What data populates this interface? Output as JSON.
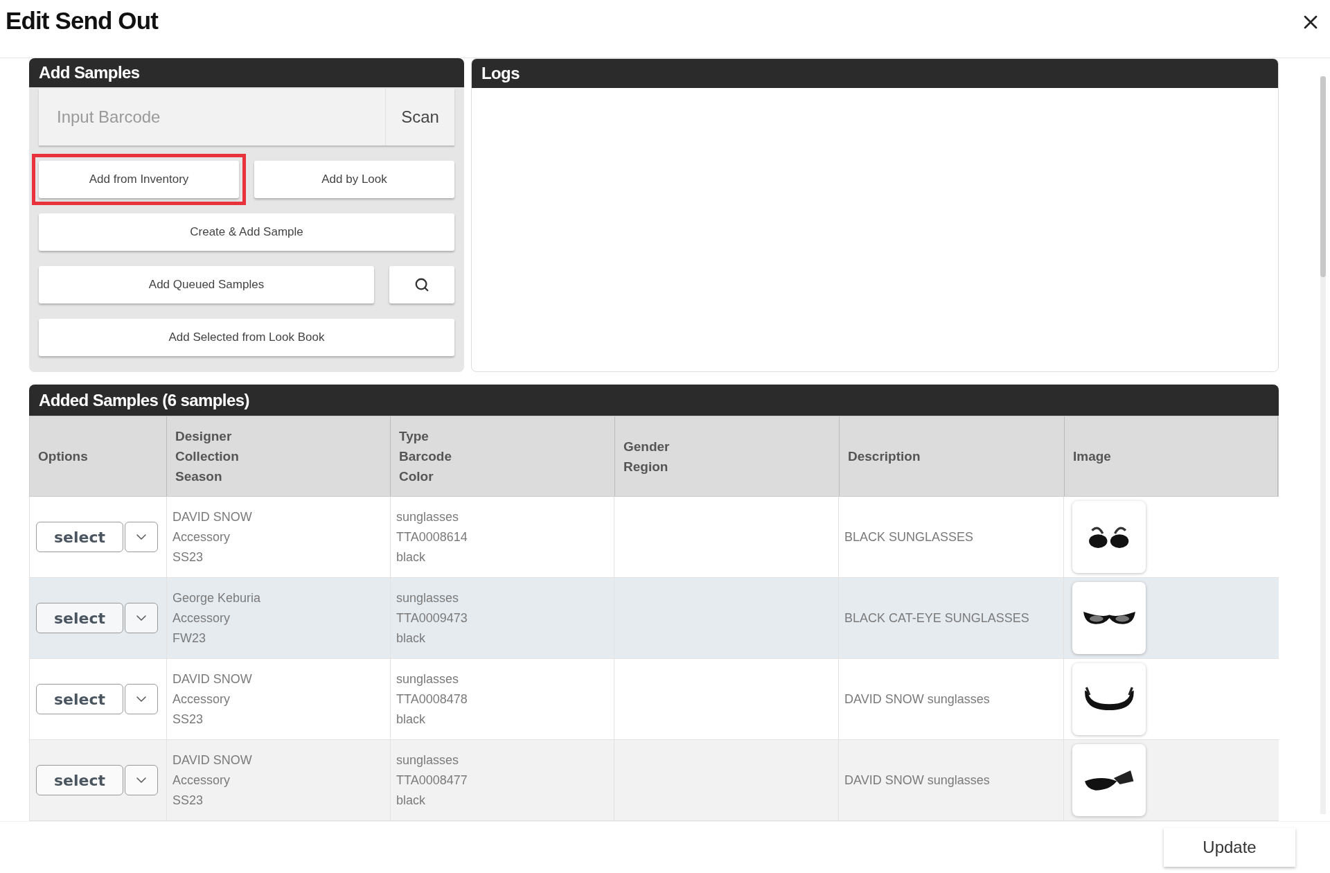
{
  "dialog": {
    "title": "Edit Send Out"
  },
  "add_samples": {
    "title": "Add Samples",
    "barcode": {
      "placeholder": "Input Barcode"
    },
    "scan_button": "Scan",
    "action_rows": [
      [
        {
          "kind": "text",
          "label": "Add from Inventory",
          "highlighted": true
        },
        {
          "kind": "text",
          "label": "Add by Look",
          "highlighted": false
        }
      ],
      [
        {
          "kind": "text",
          "label": "Create & Add Sample",
          "highlighted": false
        }
      ],
      [
        {
          "kind": "text",
          "label": "Add Queued Samples",
          "highlighted": false
        },
        {
          "kind": "search",
          "highlighted": false
        }
      ],
      [
        {
          "kind": "text",
          "label": "Add Selected from Look Book",
          "highlighted": false
        }
      ]
    ]
  },
  "logs": {
    "title": "Logs"
  },
  "added_samples": {
    "title": "Added Samples (6 samples)",
    "columns": [
      [
        "Options"
      ],
      [
        "Designer",
        "Collection",
        "Season"
      ],
      [
        "Type",
        "Barcode",
        "Color"
      ],
      [
        "Gender",
        "Region"
      ],
      [
        "Description"
      ],
      [
        "Image"
      ]
    ],
    "rows": [
      {
        "highlighted": false,
        "select": "select",
        "designer": [
          "DAVID SNOW",
          "Accessory",
          "SS23"
        ],
        "type": [
          "sunglasses",
          "TTA0008614",
          "black"
        ],
        "description": "BLACK SUNGLASSES"
      },
      {
        "highlighted": true,
        "select": "select",
        "designer": [
          "George Keburia",
          "Accessory",
          "FW23"
        ],
        "type": [
          "sunglasses",
          "TTA0009473",
          "black"
        ],
        "description": "BLACK CAT-EYE SUNGLASSES"
      },
      {
        "highlighted": false,
        "select": "select",
        "designer": [
          "DAVID SNOW",
          "Accessory",
          "SS23"
        ],
        "type": [
          "sunglasses",
          "TTA0008478",
          "black"
        ],
        "description": "DAVID SNOW sunglasses"
      },
      {
        "highlighted": false,
        "select": "select",
        "designer": [
          "DAVID SNOW",
          "Accessory",
          "SS23"
        ],
        "type": [
          "sunglasses",
          "TTA0008477",
          "black"
        ],
        "description": "DAVID SNOW sunglasses"
      }
    ]
  },
  "footer": {
    "update_button": "Update"
  }
}
